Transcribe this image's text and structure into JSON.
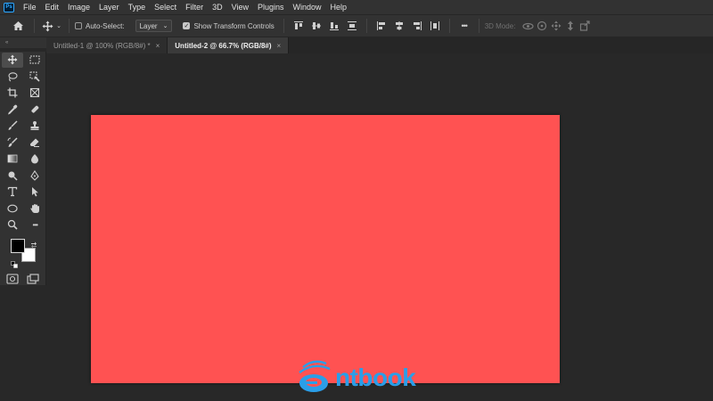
{
  "app": {
    "logo_text": "Ps",
    "menu": [
      "File",
      "Edit",
      "Image",
      "Layer",
      "Type",
      "Select",
      "Filter",
      "3D",
      "View",
      "Plugins",
      "Window",
      "Help"
    ]
  },
  "options_bar": {
    "auto_select_label": "Auto-Select:",
    "auto_select_checked": false,
    "layer_dropdown_value": "Layer",
    "transform_controls_label": "Show Transform Controls",
    "transform_controls_checked": true,
    "more_label": "•••",
    "mode_3d_label": "3D Mode:"
  },
  "tabs": [
    {
      "label": "Untitled-1 @ 100% (RGB/8#) *",
      "close": "×",
      "active": false
    },
    {
      "label": "Untitled-2 @ 66.7% (RGB/8#)",
      "close": "×",
      "active": true
    }
  ],
  "toolbar": {
    "collapse_label": "«",
    "more_tools_label": "•••"
  },
  "colors": {
    "foreground": "#000000",
    "background": "#ffffff",
    "canvas_fill": "#ff5252"
  },
  "watermark": {
    "text": "ntbook"
  }
}
